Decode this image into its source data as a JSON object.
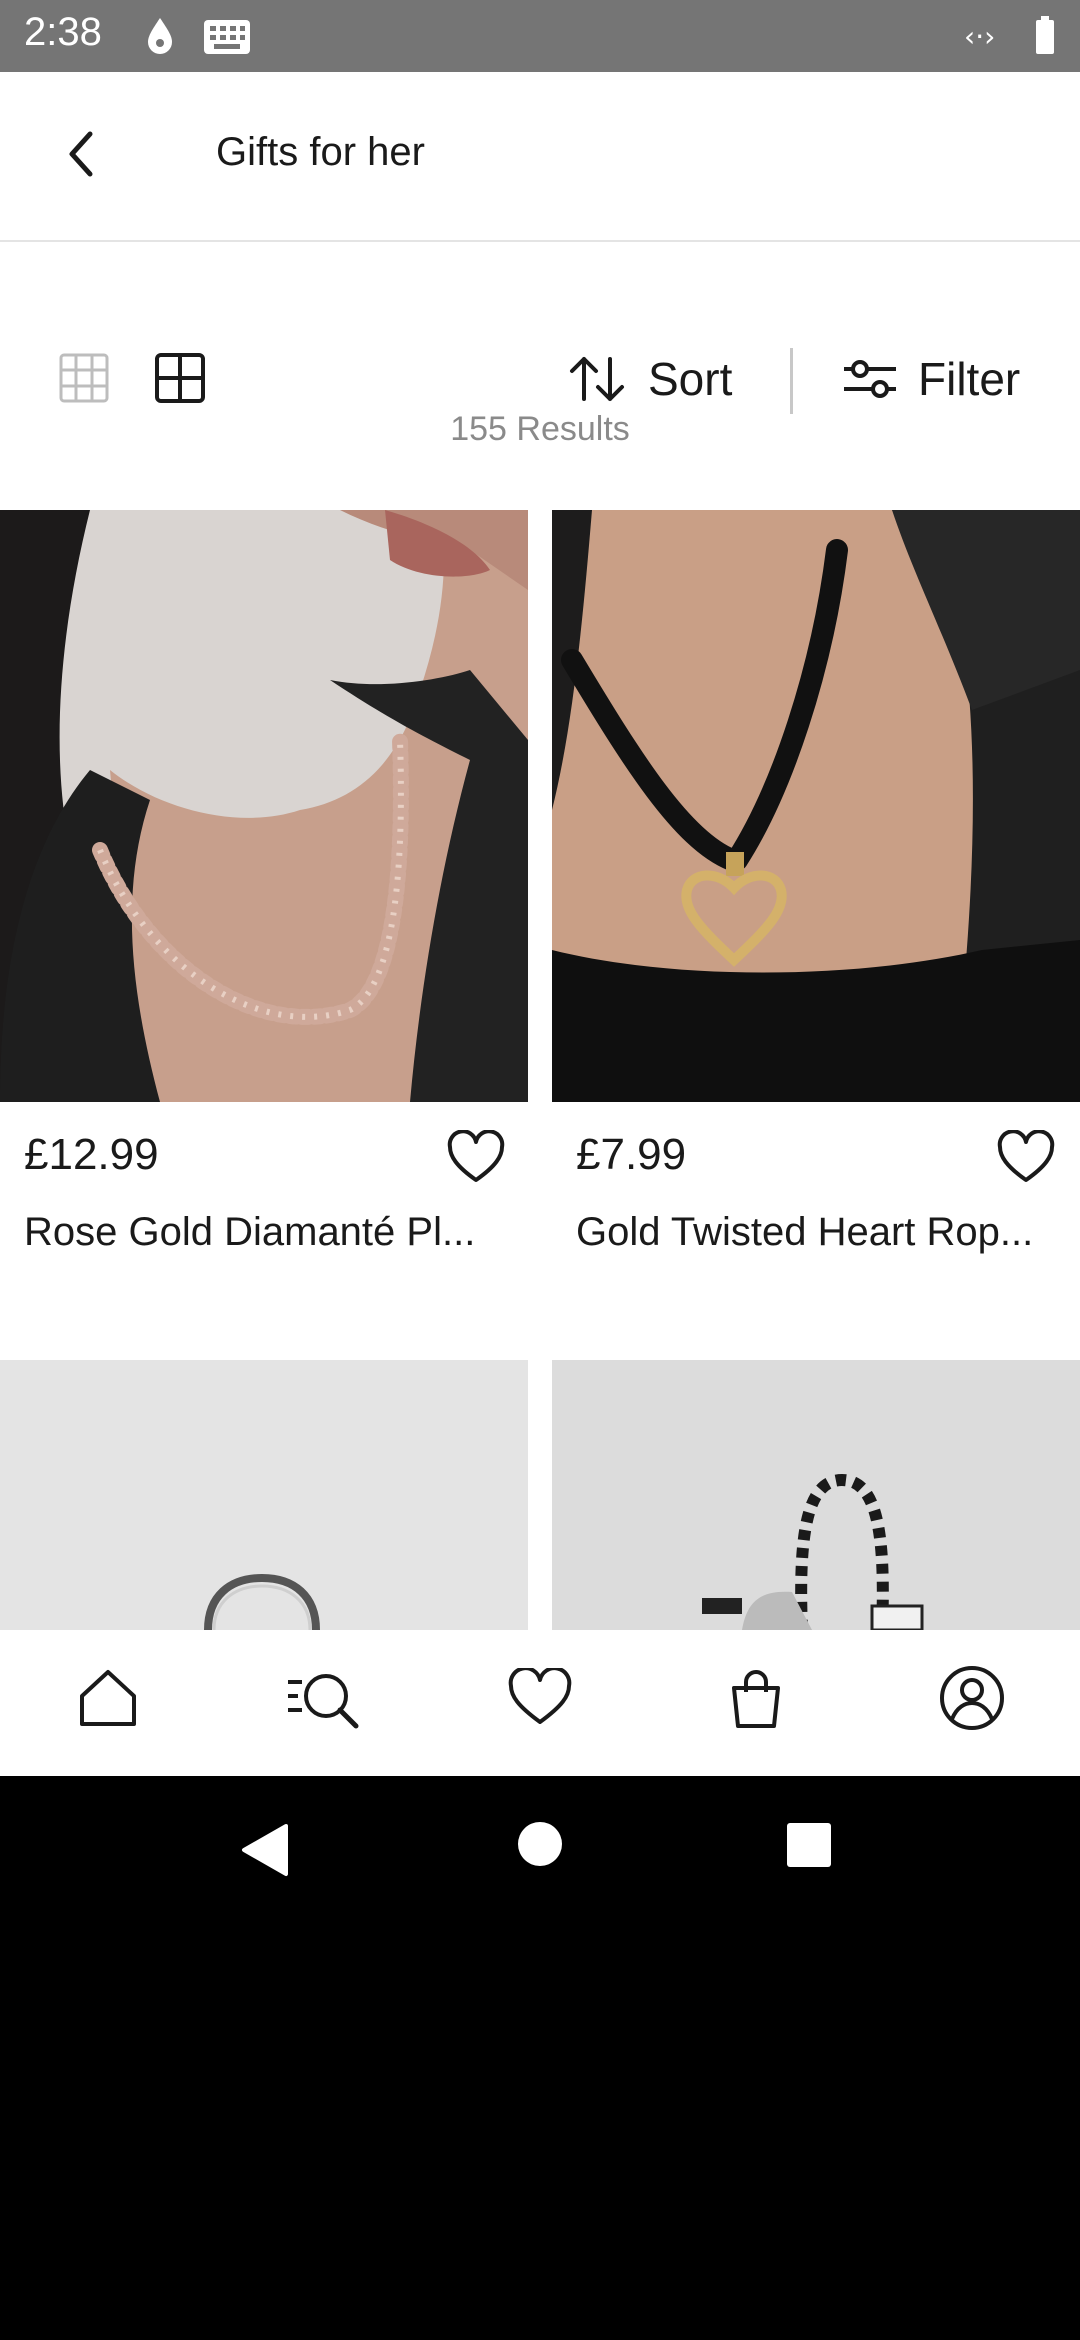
{
  "status_bar": {
    "time": "2:38",
    "icons": [
      "drop-icon",
      "keyboard-icon",
      "signal-icon",
      "battery-icon"
    ]
  },
  "header": {
    "title": "Gifts for her",
    "back_icon": "chevron-left-icon"
  },
  "toolbar": {
    "view_options": [
      "grid-3x3-icon",
      "grid-2x2-icon"
    ],
    "sort_label": "Sort",
    "filter_label": "Filter"
  },
  "results_text": "155 Results",
  "products": [
    {
      "price": "£12.99",
      "name": "Rose Gold Diamanté Pl...",
      "wishlist_icon": "heart-outline-icon"
    },
    {
      "price": "£7.99",
      "name": "Gold Twisted Heart Rop...",
      "wishlist_icon": "heart-outline-icon"
    },
    {
      "price": "",
      "name": "",
      "wishlist_icon": ""
    },
    {
      "price": "",
      "name": "",
      "wishlist_icon": ""
    }
  ],
  "bottom_nav": {
    "items": [
      "home-icon",
      "search-icon",
      "heart-icon",
      "bag-icon",
      "account-icon"
    ]
  },
  "system_nav": {
    "items": [
      "back-triangle-icon",
      "home-circle-icon",
      "recents-square-icon"
    ]
  },
  "colors": {
    "status_bar_bg": "#757575",
    "text_primary": "#1a1a1a",
    "text_secondary": "#8a8a8a"
  }
}
